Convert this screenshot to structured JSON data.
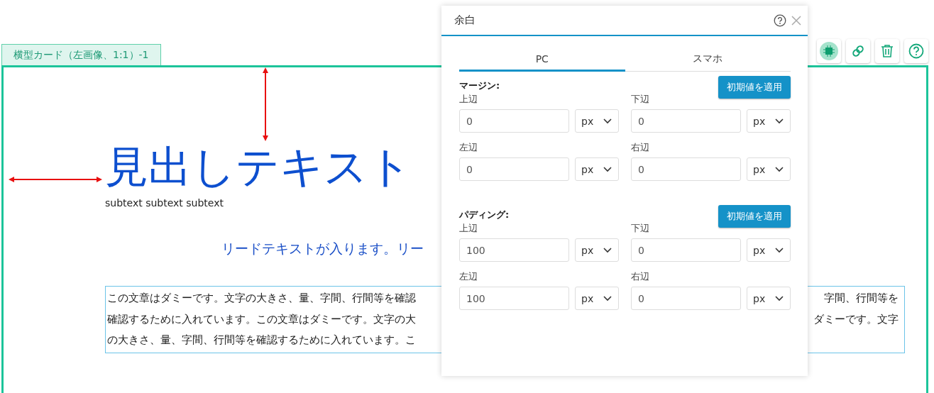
{
  "card_tab": "横型カード（左画像、1:1）-1",
  "toolbar": [
    {
      "kind": "chip",
      "selected": true
    },
    {
      "kind": "link",
      "selected": false
    },
    {
      "kind": "trash",
      "selected": false
    },
    {
      "kind": "help",
      "selected": false
    }
  ],
  "heading": "見出しテキスト",
  "subtext": "subtext subtext subtext",
  "lead_text": "リードテキストが入ります。リー",
  "body_lines": [
    {
      "left": "この文章はダミーです。文字の大きさ、量、字間、行間等を確認",
      "right": "字間、行間等を"
    },
    {
      "left": "確認するために入れています。この文章はダミーです。文字の大",
      "right": "ダミーです。文字"
    },
    {
      "left": "の大きさ、量、字間、行間等を確認するために入れています。こ"
    }
  ],
  "dialog": {
    "title": "余白",
    "tabs": [
      {
        "label": "PC",
        "selected": true
      },
      {
        "label": "スマホ",
        "selected": false
      }
    ],
    "sections": [
      {
        "title": "マージン:",
        "button": "初期値を適用",
        "fields": [
          {
            "label": "上辺",
            "value": "0",
            "unit": "px"
          },
          {
            "label": "下辺",
            "value": "0",
            "unit": "px"
          },
          {
            "label": "左辺",
            "value": "0",
            "unit": "px"
          },
          {
            "label": "右辺",
            "value": "0",
            "unit": "px"
          }
        ]
      },
      {
        "title": "パディング:",
        "button": "初期値を適用",
        "fields": [
          {
            "label": "上辺",
            "value": "100",
            "unit": "px"
          },
          {
            "label": "下辺",
            "value": "0",
            "unit": "px"
          },
          {
            "label": "左辺",
            "value": "100",
            "unit": "px"
          },
          {
            "label": "右辺",
            "value": "0",
            "unit": "px"
          }
        ]
      }
    ]
  }
}
